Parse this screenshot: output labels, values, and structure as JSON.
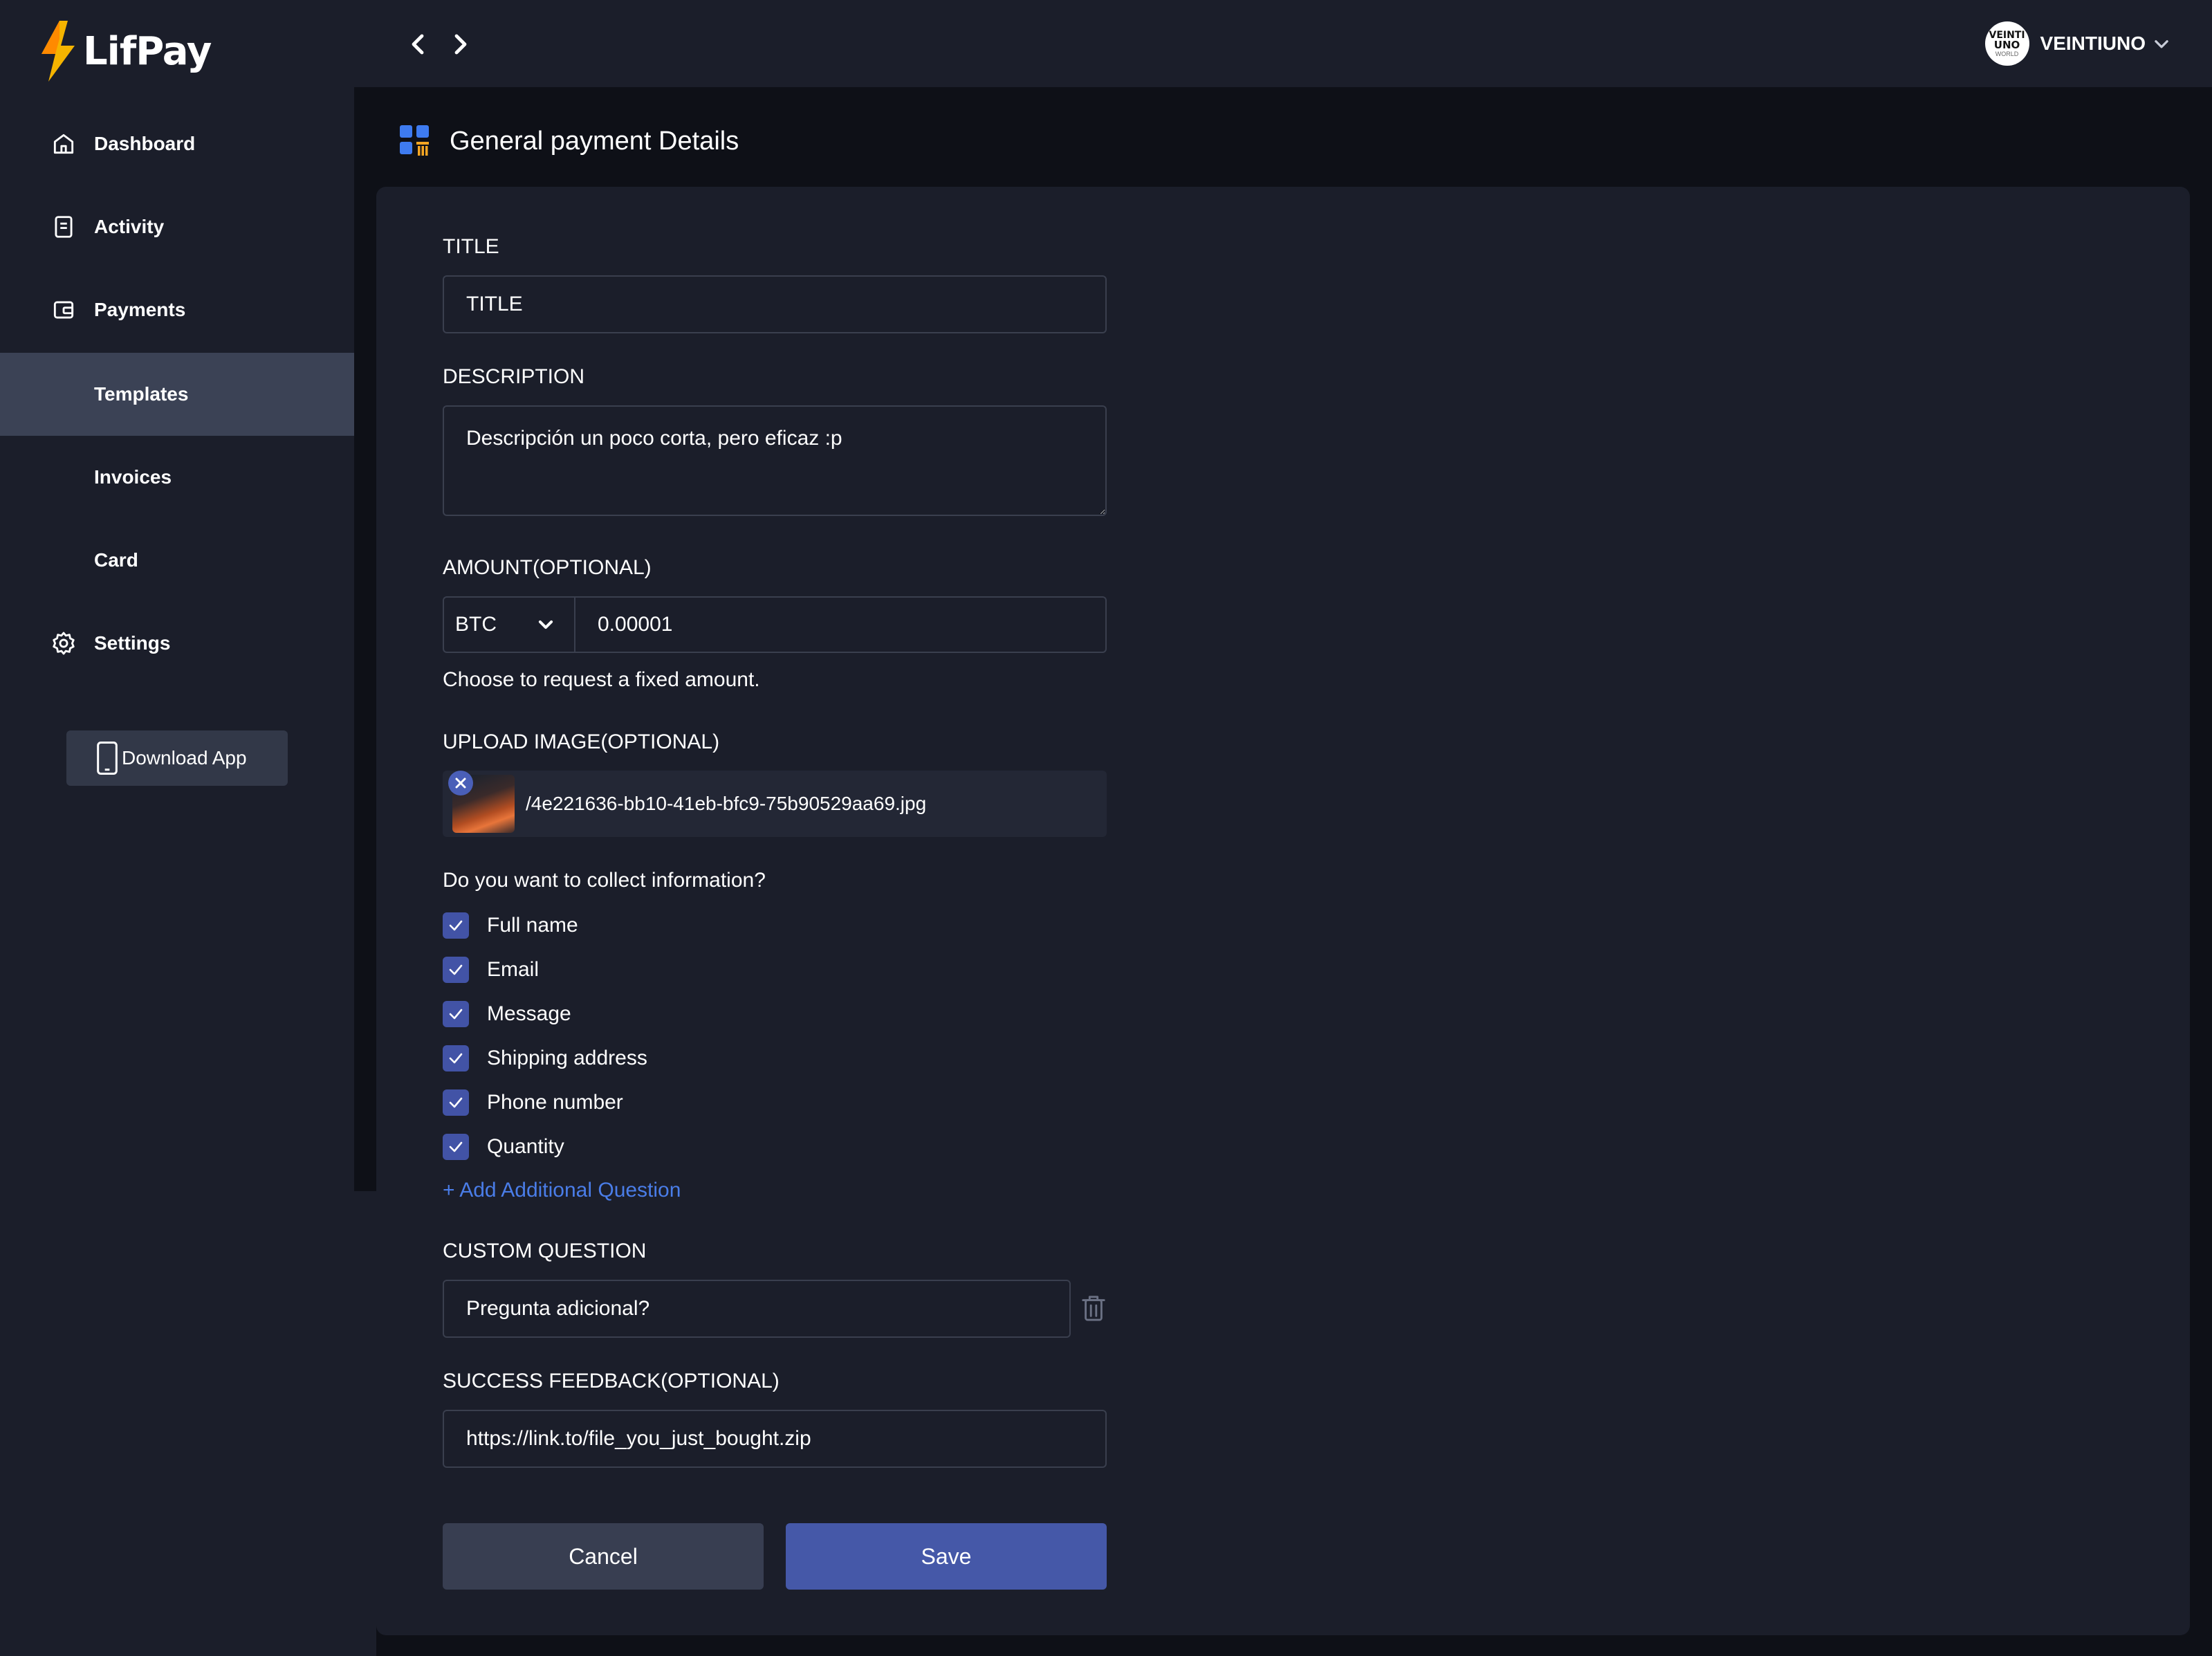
{
  "app": {
    "brand": "LifPay",
    "brand_color": "#f5b400"
  },
  "sidebar": {
    "items": [
      {
        "label": "Dashboard",
        "icon": "home-icon"
      },
      {
        "label": "Activity",
        "icon": "document-icon"
      },
      {
        "label": "Payments",
        "icon": "wallet-icon"
      },
      {
        "label": "Templates",
        "icon": "",
        "active": true
      },
      {
        "label": "Invoices",
        "icon": ""
      },
      {
        "label": "Card",
        "icon": ""
      },
      {
        "label": "Settings",
        "icon": "gear-icon"
      }
    ],
    "download_label": "Download App"
  },
  "topbar": {
    "user_name": "VEINTIUNO",
    "avatar": {
      "line1": "VEINTI",
      "line2": "UNO",
      "line3": "WORLD"
    }
  },
  "page": {
    "title": "General payment Details"
  },
  "form": {
    "title": {
      "label": "TITLE",
      "value": "TITLE"
    },
    "description": {
      "label": "DESCRIPTION",
      "value": "Descripción un poco corta, pero eficaz :p"
    },
    "amount": {
      "label": "AMOUNT(OPTIONAL)",
      "currency": "BTC",
      "value": "0.00001",
      "hint": "Choose to request a fixed amount."
    },
    "upload": {
      "label": "UPLOAD IMAGE(OPTIONAL)",
      "file_name": "/4e221636-bb10-41eb-bfc9-75b90529aa69.jpg"
    },
    "collect": {
      "question": "Do you want to collect information?",
      "options": [
        {
          "label": "Full name",
          "checked": true
        },
        {
          "label": "Email",
          "checked": true
        },
        {
          "label": "Message",
          "checked": true
        },
        {
          "label": "Shipping address",
          "checked": true
        },
        {
          "label": "Phone number",
          "checked": true
        },
        {
          "label": "Quantity",
          "checked": true
        }
      ],
      "add_label": "+ Add Additional Question"
    },
    "custom_question": {
      "label": "CUSTOM QUESTION",
      "value": "Pregunta adicional?"
    },
    "success_feedback": {
      "label": "SUCCESS FEEDBACK(OPTIONAL)",
      "value": "https://link.to/file_you_just_bought.zip"
    },
    "cancel_label": "Cancel",
    "save_label": "Save"
  },
  "colors": {
    "accent": "#4558a8",
    "checkbox": "#4253a6",
    "link": "#4a7de8",
    "sidebar_active": "#3b4255",
    "background": "#1b1e2a"
  }
}
